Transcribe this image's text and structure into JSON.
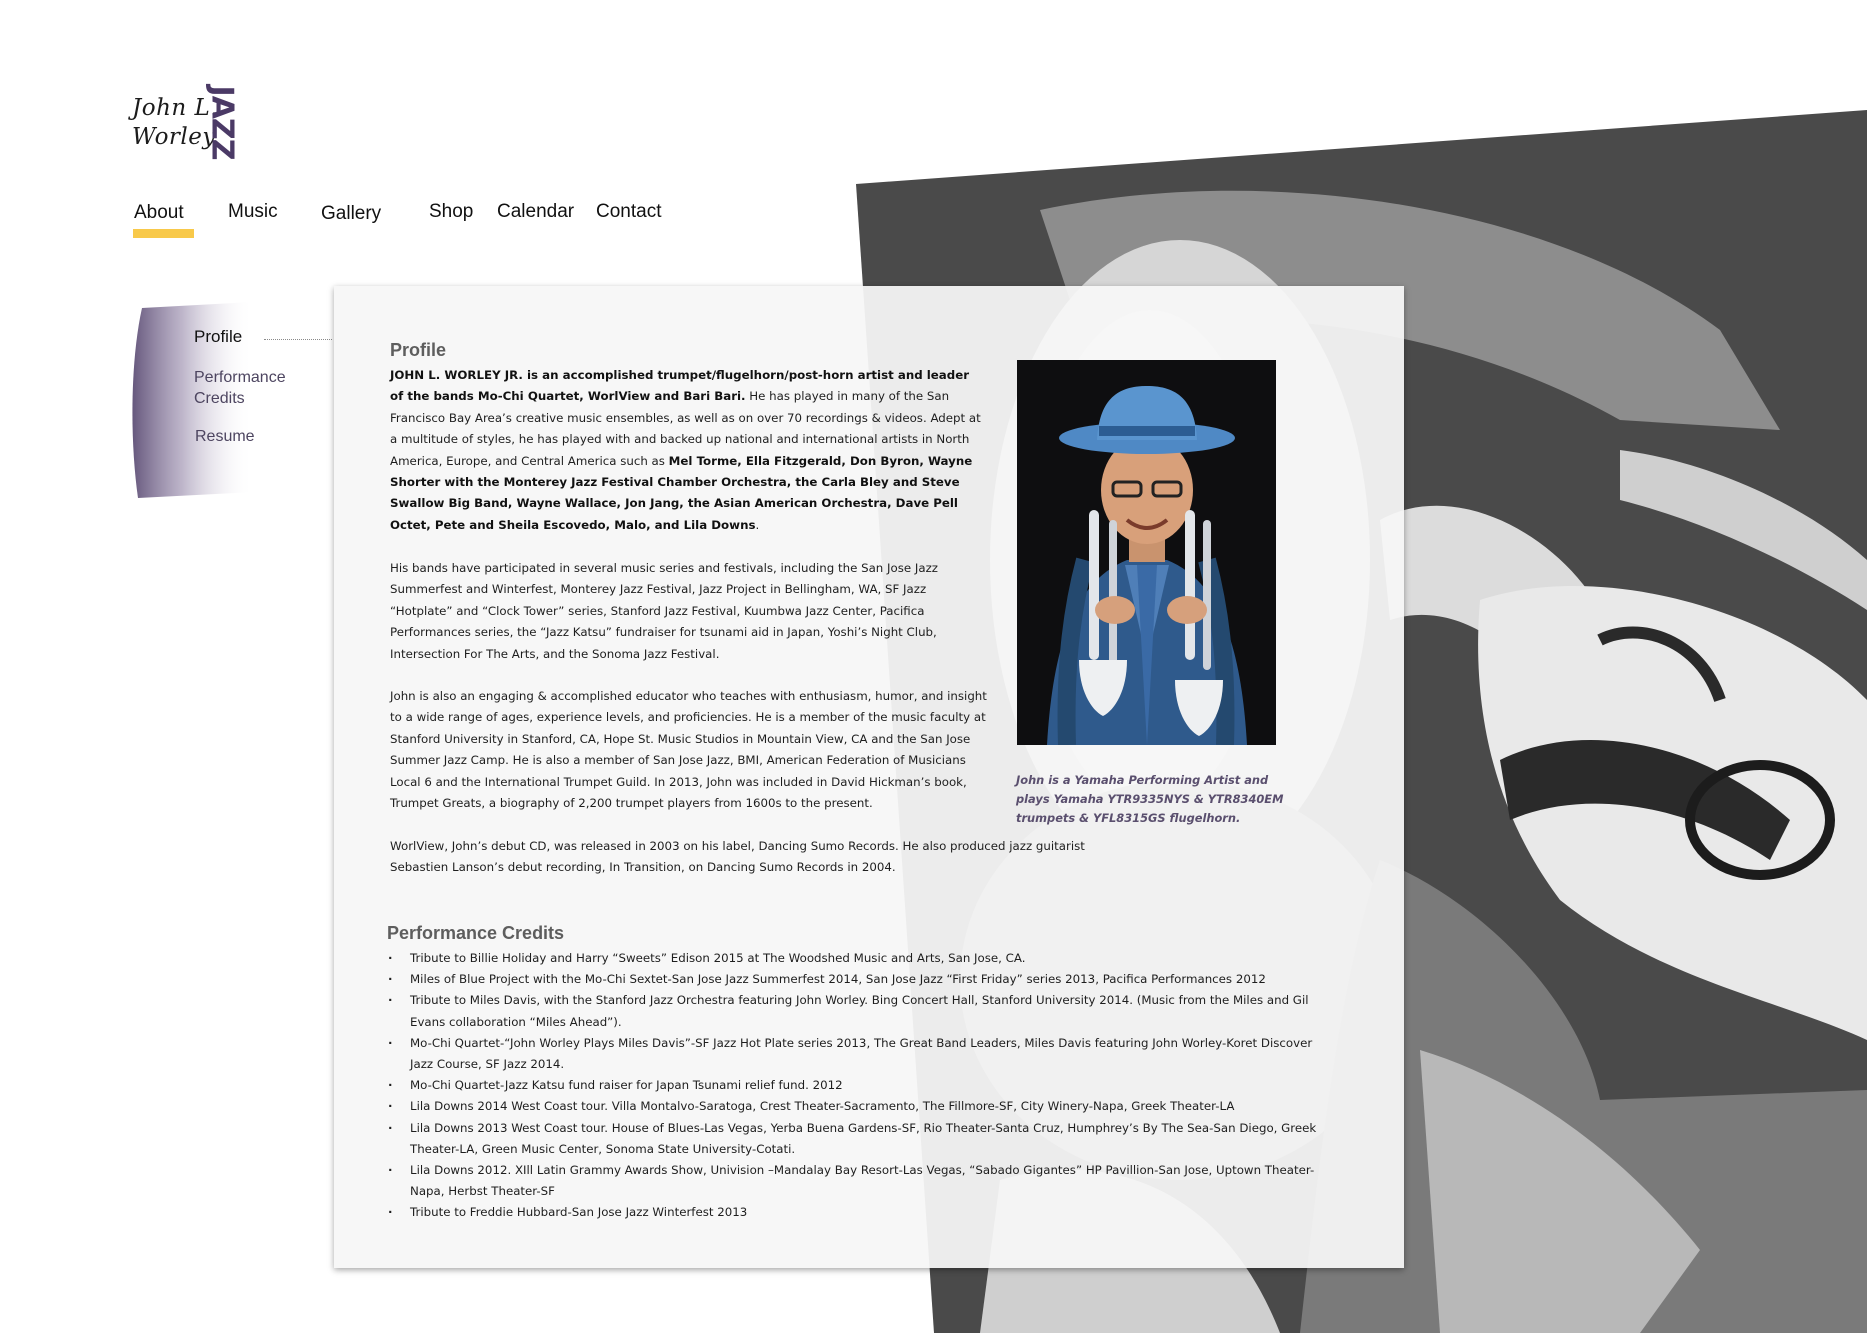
{
  "logo": {
    "line1": "John L.",
    "line2": "Worley",
    "word": "JAZZ"
  },
  "nav": {
    "items": [
      {
        "label": "About",
        "active": true
      },
      {
        "label": "Music"
      },
      {
        "label": "Gallery"
      },
      {
        "label": "Shop"
      },
      {
        "label": "Calendar"
      },
      {
        "label": "Contact"
      }
    ]
  },
  "subnav": {
    "items": [
      {
        "label": "Profile",
        "active": true
      },
      {
        "label": "Performance Credits"
      },
      {
        "label": "Resume"
      }
    ]
  },
  "profile": {
    "title": "Profile",
    "p1_bold": "JOHN L. WORLEY JR. is an accomplished trumpet/flugelhorn/post-horn artist and leader of the bands Mo-Chi Quartet, WorlView and Bari Bari.",
    "p1_text": " He has played in many of the San Francisco Bay Area’s creative music ensembles, as well as on over 70 recordings & videos. Adept at a multitude of styles, he has played with and backed up national and international artists in North America, Europe, and Central America such as ",
    "p1_bold2": "Mel Torme, Ella Fitzgerald, Don Byron, Wayne Shorter with the Monterey Jazz Festival Chamber Orchestra, the Carla Bley and Steve Swallow Big Band, Wayne Wallace, Jon Jang, the Asian American Orchestra, Dave Pell Octet, Pete and Sheila Escovedo, Malo, and Lila Downs",
    "p1_end": ".",
    "p2": "His bands have participated in several music series and festivals, including the San Jose Jazz Summerfest and Winterfest, Monterey Jazz Festival, Jazz Project in Bellingham, WA, SF Jazz “Hotplate” and “Clock Tower” series, Stanford Jazz Festival, Kuumbwa Jazz Center, Pacifica Performances series, the “Jazz Katsu” fundraiser for tsunami aid in Japan, Yoshi’s Night Club, Intersection For The Arts, and the Sonoma Jazz Festival.",
    "p3": "John is also an engaging & accomplished educator who teaches with enthusiasm, humor, and insight to a wide range of ages, experience levels, and proficiencies. He is a member of the music faculty at Stanford University in Stanford, CA, Hope St. Music Studios in Mountain View, CA and the San Jose Summer Jazz Camp. He is also a member of San Jose Jazz,  BMI,  American Federation of Musicians Local 6 and the International Trumpet Guild. In 2013, John was included in David Hickman’s book, Trumpet Greats, a biography of 2,200 trumpet players from 1600s to the present.",
    "p4": "WorlView, John’s debut CD, was released in 2003 on his label, Dancing Sumo Records. He also produced jazz guitarist Sebastien Lanson’s debut recording, In Transition, on Dancing Sumo Records in 2004.",
    "caption": "John is a Yamaha Performing Artist and plays Yamaha YTR9335NYS & YTR8340EM trumpets & YFL8315GS flugelhorn."
  },
  "credits": {
    "title": "Performance Credits",
    "items": [
      "Tribute to Billie Holiday and Harry “Sweets” Edison 2015 at The Woodshed Music and Arts, San Jose, CA.",
      "Miles of Blue Project with the Mo-Chi Sextet-San Jose Jazz Summerfest 2014, San Jose Jazz “First Friday” series 2013, Pacifica Performances 2012",
      "Tribute to Miles Davis, with the Stanford Jazz Orchestra featuring John Worley.  Bing Concert Hall, Stanford University 2014.  (Music from the Miles and Gil Evans collaboration “Miles Ahead”).",
      "Mo-Chi Quartet-“John Worley Plays Miles Davis”-SF Jazz Hot Plate series 2013, The Great  Band Leaders, Miles Davis featuring John Worley-Koret Discover Jazz Course, SF Jazz 2014.",
      "Mo-Chi Quartet-Jazz Katsu fund raiser for Japan Tsunami relief fund. 2012",
      "Lila Downs 2014 West Coast tour.  Villa Montalvo-Saratoga, Crest Theater-Sacramento, The Fillmore-SF, City Winery-Napa, Greek Theater-LA",
      "Lila Downs 2013 West Coast tour.  House of Blues-Las Vegas, Yerba Buena Gardens-SF, Rio Theater-Santa Cruz, Humphrey’s By The Sea-San Diego, Greek Theater-LA, Green Music Center, Sonoma State University-Cotati.",
      "Lila Downs 2012. XIll Latin Grammy Awards Show, Univision –Mandalay Bay Resort-Las Vegas, “Sabado Gigantes” HP Pavillion-San Jose, Uptown Theater-Napa, Herbst Theater-SF",
      "Tribute to Freddie Hubbard-San Jose Jazz Winterfest 2013"
    ]
  },
  "colors": {
    "accent": "#f8c94a",
    "brand_purple": "#4b3a66",
    "panel": "#f7f7f7"
  }
}
